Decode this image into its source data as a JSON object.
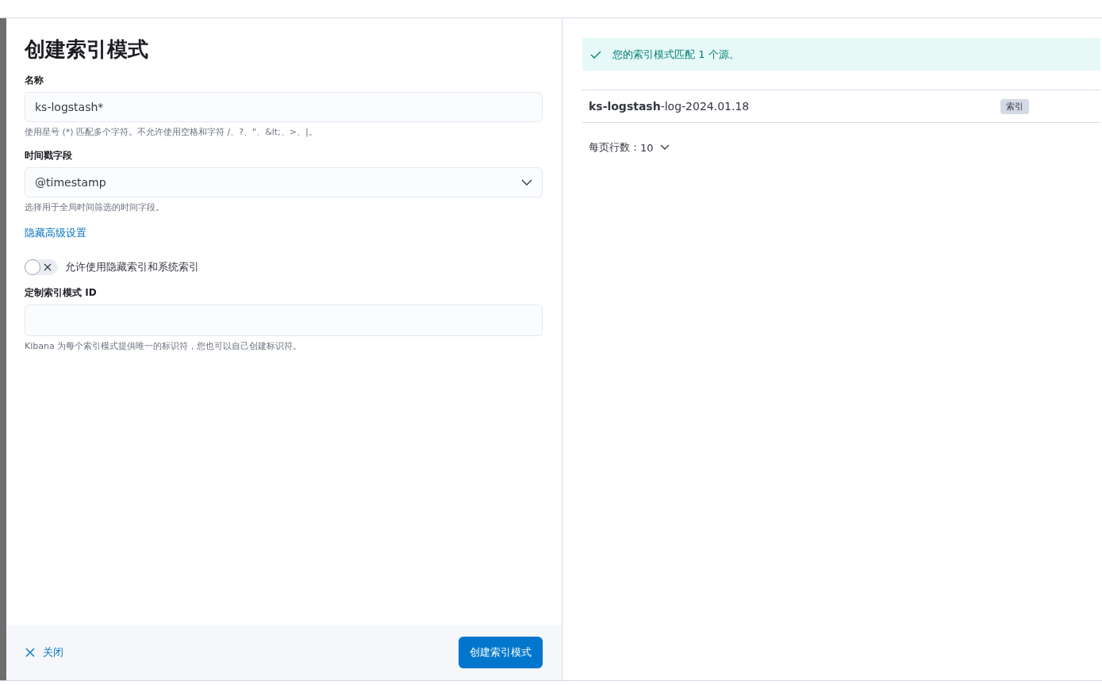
{
  "form": {
    "title": "创建索引模式",
    "name_field": {
      "label": "名称",
      "value": "ks-logstash*",
      "help": "使用星号 (*) 匹配多个字符。不允许使用空格和字符 /、?、\"、&lt;、>、|。"
    },
    "timestamp_field": {
      "label": "时间戳字段",
      "value": "@timestamp",
      "help": "选择用于全局时间筛选的时间字段。"
    },
    "advanced_link": "隐藏高级设置",
    "hidden_toggle": {
      "label": "允许使用隐藏索引和系统索引",
      "on": false
    },
    "id_field": {
      "label": "定制索引模式 ID",
      "help": "Kibana 为每个索引模式提供唯一的标识符，您也可以自己创建标识符。"
    },
    "footer": {
      "close": "关闭",
      "create": "创建索引模式"
    }
  },
  "results": {
    "callout": "您的索引模式匹配 1 个源。",
    "rows": [
      {
        "name": "**ks-logstash**-log-2024.01.18",
        "tag": "索引"
      }
    ],
    "rows_per_page": {
      "label": "每页行数：",
      "value": "10"
    }
  }
}
